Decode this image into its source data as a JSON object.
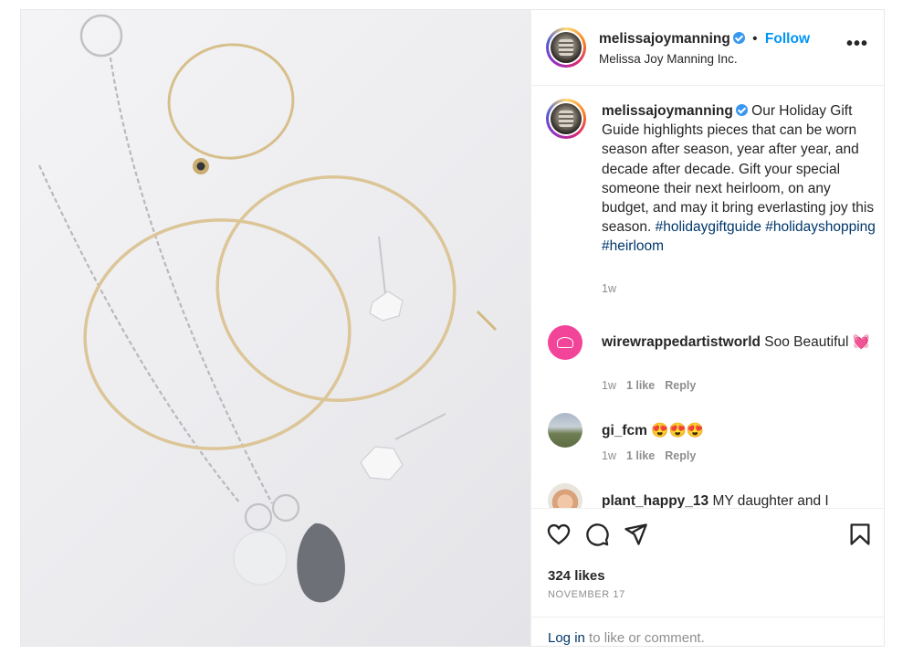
{
  "post": {
    "image_alt": "jewelry flatlay photo"
  },
  "header": {
    "username": "melissajoymanning",
    "separator": "•",
    "follow_label": "Follow",
    "subtitle": "Melissa Joy Manning Inc.",
    "more_label": "•••"
  },
  "caption": {
    "username": "melissajoymanning",
    "text": " Our Holiday Gift Guide highlights pieces that can be worn season after season, year after year, and decade after decade. Gift your special someone their next heirloom, on any budget, and may it bring everlasting joy this season. ",
    "hashtags": [
      "#holidaygiftguide",
      "#holidayshopping",
      "#heirloom"
    ],
    "time": "1w"
  },
  "comments": [
    {
      "username": "wirewrappedartistworld",
      "text": " Soo Beautiful 💓",
      "time": "1w",
      "likes": "1 like",
      "reply": "Reply"
    },
    {
      "username": "gi_fcm",
      "text": " 😍😍😍",
      "time": "1w",
      "likes": "1 like",
      "reply": "Reply"
    },
    {
      "username": "plant_happy_13",
      "text": " MY daughter and I",
      "time": "",
      "likes": "",
      "reply": ""
    }
  ],
  "actions": {
    "icons": [
      "heart-icon",
      "comment-icon",
      "share-icon",
      "bookmark-icon"
    ],
    "likes": "324 likes",
    "date": "NOVEMBER 17"
  },
  "footer": {
    "login_link": "Log in",
    "login_rest": " to like or comment."
  },
  "colors": {
    "link_blue": "#0095f6",
    "hashtag": "#00376b",
    "muted": "#8e8e8e",
    "verified": "#3897f0"
  }
}
